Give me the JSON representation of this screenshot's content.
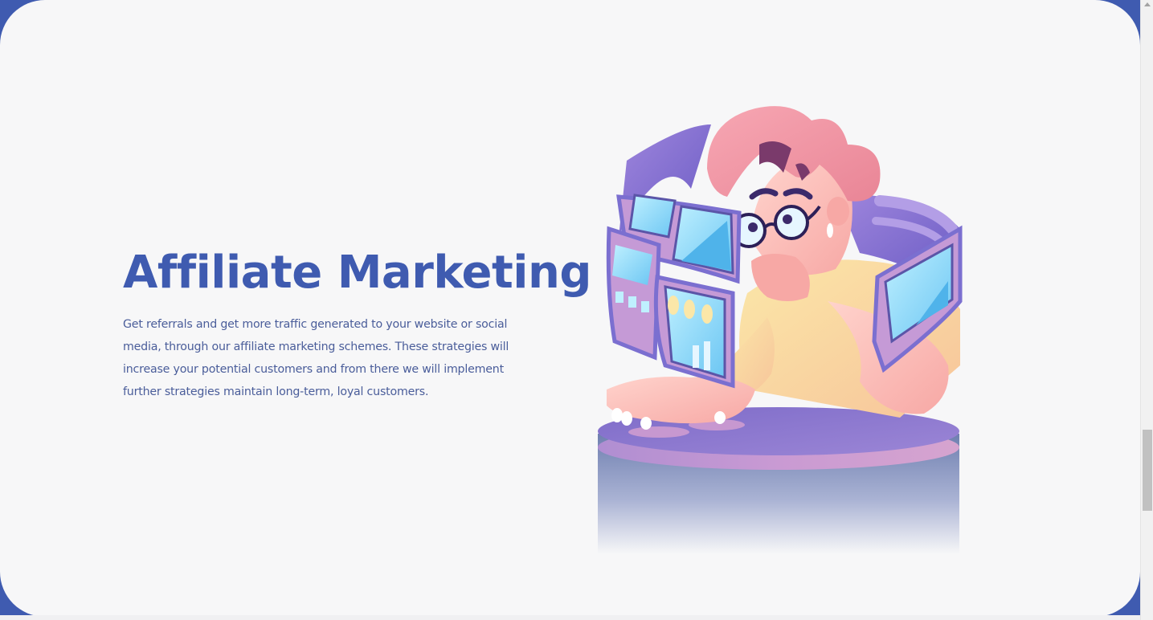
{
  "section": {
    "title": "Affiliate Marketing",
    "description": "Get referrals and get more traffic generated to your website or social media, through our affiliate marketing schemes. These strategies will increase your potential customers and from there we will implement further strategies maintain long-term, loyal customers."
  },
  "illustration": {
    "icon": "person-with-screens-illustration"
  },
  "colors": {
    "heading": "#3f5bb0",
    "body_text": "#4a5d9a",
    "card_background": "#f7f7f8",
    "accent_purple": "#7b6fd0",
    "accent_pink": "#f4a0ad"
  }
}
